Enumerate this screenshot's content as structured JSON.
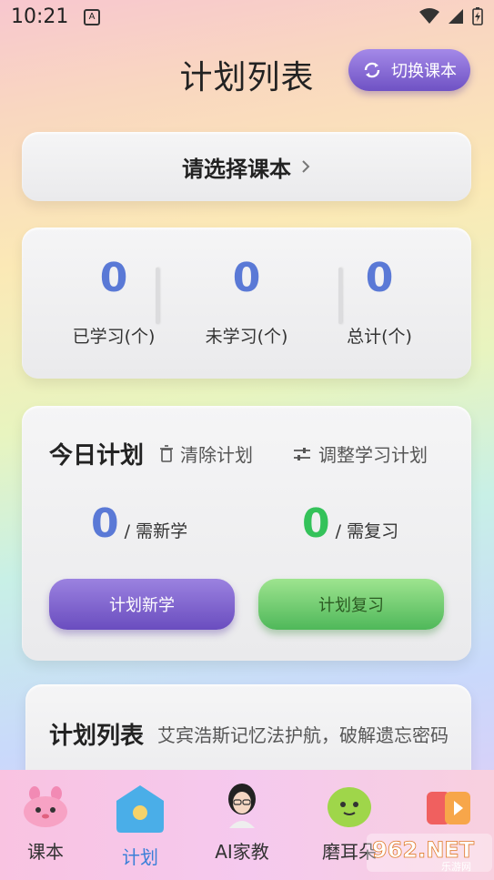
{
  "status_bar": {
    "time": "10:21"
  },
  "header": {
    "title": "计划列表",
    "switch_label": "切换课本"
  },
  "textbook_select": {
    "label": "请选择课本"
  },
  "stats": [
    {
      "value": "0",
      "label": "已学习(个)"
    },
    {
      "value": "0",
      "label": "未学习(个)"
    },
    {
      "value": "0",
      "label": "总计(个)"
    }
  ],
  "today_plan": {
    "title": "今日计划",
    "clear_label": "清除计划",
    "adjust_label": "调整学习计划",
    "new_count": "0",
    "new_label": "/ 需新学",
    "review_count": "0",
    "review_label": "/ 需复习",
    "new_button": "计划新学",
    "review_button": "计划复习"
  },
  "plan_list": {
    "title": "计划列表",
    "subtitle": "艾宾浩斯记忆法护航，破解遗忘密码"
  },
  "tabs": [
    {
      "label": "课本",
      "icon": "pink-bunny-icon"
    },
    {
      "label": "计划",
      "icon": "plan-house-icon",
      "active": true
    },
    {
      "label": "AI家教",
      "icon": "ai-tutor-avatar-icon"
    },
    {
      "label": "磨耳朵",
      "icon": "green-blob-icon"
    },
    {
      "label": "",
      "icon": "video-play-icon"
    }
  ],
  "watermark": {
    "brand": "962.NET",
    "sub": "乐游网"
  },
  "colors": {
    "stat_blue": "#5a79d6",
    "review_green": "#34c25a",
    "accent_purple": "#6f52c4",
    "active_tab": "#3a7fd8"
  }
}
